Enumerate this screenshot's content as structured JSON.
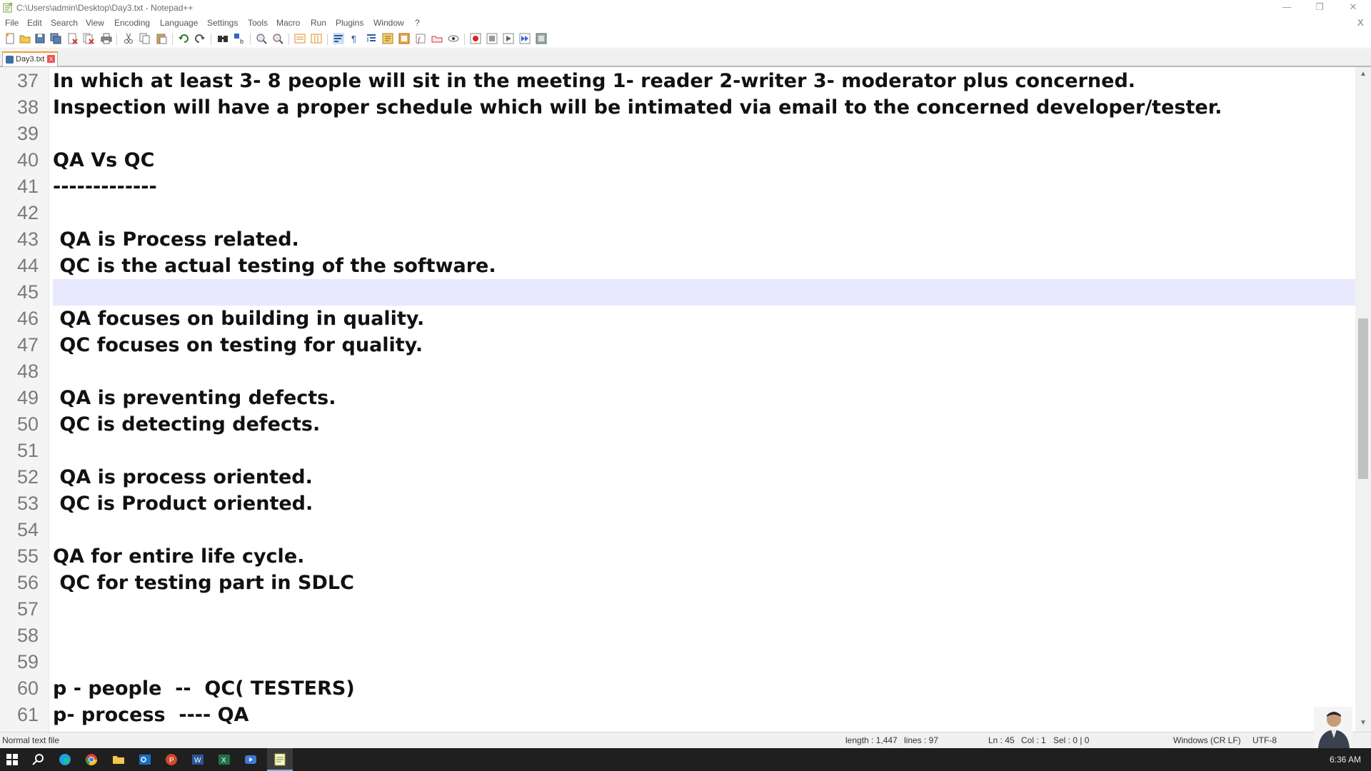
{
  "window": {
    "title": "C:\\Users\\admin\\Desktop\\Day3.txt - Notepad++",
    "min_glyph": "—",
    "max_glyph": "❐",
    "close_glyph": "✕",
    "doc_close_glyph": "X"
  },
  "menu": [
    "File",
    "Edit",
    "Search",
    "View",
    "Encoding",
    "Language",
    "Settings",
    "Tools",
    "Macro",
    "Run",
    "Plugins",
    "Window",
    "?"
  ],
  "toolbar_icons": [
    "new-file-icon",
    "open-file-icon",
    "save-icon",
    "save-all-icon",
    "close-icon",
    "close-all-icon",
    "print-icon",
    "cut-icon",
    "copy-icon",
    "paste-icon",
    "undo-icon",
    "redo-icon",
    "find-icon",
    "replace-icon",
    "zoom-in-icon",
    "zoom-out-icon",
    "sync-vertical-icon",
    "sync-horizontal-icon",
    "word-wrap-icon",
    "show-all-chars-icon",
    "indent-guide-icon",
    "user-defined-lang-icon",
    "doc-map-icon",
    "function-list-icon",
    "folder-workspace-icon",
    "monitoring-icon",
    "record-macro-icon",
    "stop-macro-icon",
    "play-macro-icon",
    "run-macro-multiple-icon",
    "save-macro-icon"
  ],
  "tab": {
    "label": "Day3.txt",
    "close_glyph": "x"
  },
  "editor": {
    "current_line": 45,
    "lines": [
      {
        "n": "37",
        "text": "In which at least 3- 8 people will sit in the meeting 1- reader 2-writer 3- moderator plus concerned."
      },
      {
        "n": "38",
        "text": "Inspection will have a proper schedule which will be intimated via email to the concerned developer/tester."
      },
      {
        "n": "39",
        "text": ""
      },
      {
        "n": "40",
        "text": "QA Vs QC"
      },
      {
        "n": "41",
        "text": "-------------"
      },
      {
        "n": "42",
        "text": ""
      },
      {
        "n": "43",
        "text": " QA is Process related."
      },
      {
        "n": "44",
        "text": " QC is the actual testing of the software."
      },
      {
        "n": "45",
        "text": ""
      },
      {
        "n": "46",
        "text": " QA focuses on building in quality."
      },
      {
        "n": "47",
        "text": " QC focuses on testing for quality."
      },
      {
        "n": "48",
        "text": ""
      },
      {
        "n": "49",
        "text": " QA is preventing defects."
      },
      {
        "n": "50",
        "text": " QC is detecting defects."
      },
      {
        "n": "51",
        "text": ""
      },
      {
        "n": "52",
        "text": " QA is process oriented."
      },
      {
        "n": "53",
        "text": " QC is Product oriented."
      },
      {
        "n": "54",
        "text": ""
      },
      {
        "n": "55",
        "text": "QA for entire life cycle."
      },
      {
        "n": "56",
        "text": " QC for testing part in SDLC"
      },
      {
        "n": "57",
        "text": ""
      },
      {
        "n": "58",
        "text": ""
      },
      {
        "n": "59",
        "text": ""
      },
      {
        "n": "60",
        "text": "p - people  --  QC( TESTERS)"
      },
      {
        "n": "61",
        "text": "p- process  ---- QA"
      }
    ]
  },
  "status": {
    "file_type": "Normal text file",
    "length": "length : 1,447",
    "lines": "lines : 97",
    "ln": "Ln : 45",
    "col": "Col : 1",
    "sel": "Sel : 0 | 0",
    "eol": "Windows (CR LF)",
    "encoding": "UTF-8"
  },
  "taskbar": {
    "icons": [
      "windows-start-icon",
      "search-icon",
      "edge-icon",
      "chrome-icon",
      "file-explorer-icon",
      "outlook-icon",
      "powerpoint-icon",
      "word-icon",
      "excel-icon",
      "video-app-icon",
      "notepadpp-icon"
    ],
    "clock": "6:36 AM"
  }
}
